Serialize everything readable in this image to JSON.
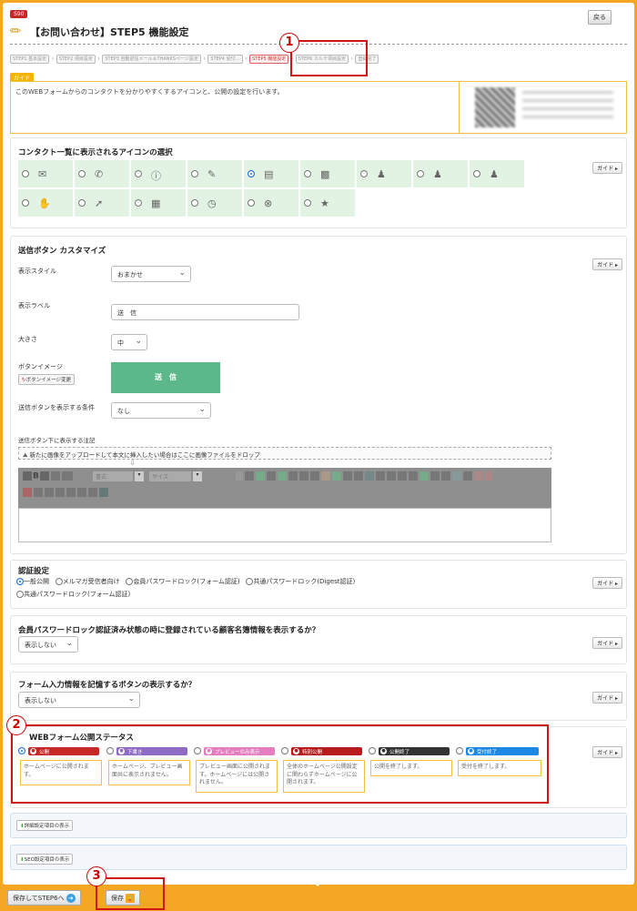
{
  "header": {
    "mark": "S90",
    "title": "【お問い合わせ】STEP5 機能設定",
    "back_label": "戻る"
  },
  "steps": [
    "STEP1 基本設定",
    "STEP2 項目設定",
    "STEP3 自動返信メール＆THANKSページ設定",
    "STEP4 受付…",
    "STEP5 機能設定",
    "STEP6 カルテ項目設定",
    "登録完了"
  ],
  "guide": {
    "badge": "ガイド",
    "text": "このWEBフォームからのコンタクトを分かりやすくするアイコンと、公開の設定を行います。"
  },
  "guide_btn": "ガイド",
  "icon_section": {
    "title": "コンタクト一覧に表示されるアイコンの選択",
    "icons": [
      "envelope-icon",
      "phone-icon",
      "exclamation-icon",
      "pencil-icon",
      "document-icon",
      "notepad-icon",
      "person-icon",
      "person-alt-icon",
      "group-icon",
      "handshake-icon",
      "arrow-icon",
      "calendar-icon",
      "clock-icon",
      "cancel-icon",
      "star-icon"
    ],
    "icon_glyphs": [
      "✉",
      "✆",
      "ⓘ",
      "✎",
      "▤",
      "▩",
      "♟",
      "♟",
      "♟",
      "✋",
      "➚",
      "▦",
      "◷",
      "⊗",
      "★"
    ],
    "selected": 4
  },
  "send_button": {
    "title": "送信ボタン カスタマイズ",
    "style_label": "表示スタイル",
    "style_value": "おまかせ",
    "display_label": "表示ラベル",
    "display_value": "送　信",
    "size_label": "大きさ",
    "size_value": "中",
    "image_label": "ボタンイメージ",
    "image_btn": "ボタンイメージ変更",
    "preview_label": "送　信",
    "condition_label": "送信ボタンを表示する条件",
    "condition_value": "なし",
    "note_label": "送信ボタン下に表示する注記",
    "dropzone": "新たに画像をアップロードして本文に挿入したい場合はここに画像ファイルをドロップ",
    "toolbar_format": "書式",
    "toolbar_size": "サイズ"
  },
  "auth": {
    "title": "認証設定",
    "options": [
      "一般公開",
      "メルマガ受信者向け",
      "会員パスワードロック(フォーム認証)",
      "共通パスワードロック(Digest認証)",
      "共通パスワードロック(フォーム認証)"
    ],
    "selected": 0
  },
  "member_info": {
    "title": "会員パスワードロック認証済み状態の時に登録されている顧客名簿情報を表示するか？",
    "value": "表示しない"
  },
  "remember": {
    "title": "フォーム入力情報を記憶するボタンの表示するか？",
    "value": "表示しない"
  },
  "publish": {
    "title": "WEBフォーム公開ステータス",
    "selected": 0,
    "options": [
      {
        "label": "公開",
        "color": "#c62828",
        "desc": "ホームページに公開されます。"
      },
      {
        "label": "下書き",
        "color": "#8e6bc4",
        "desc": "ホームページ、プレビュー画面共に表示されません。"
      },
      {
        "label": "プレビューのみ表示",
        "color": "#e57ec0",
        "desc": "プレビュー画面に公開されます。ホームページには公開されません。"
      },
      {
        "label": "特別公開",
        "color": "#b71c1c",
        "desc": "全体のホームページ公開設定に関わらずホームページに公開されます。"
      },
      {
        "label": "公開終了",
        "color": "#333333",
        "desc": "公開を終了します。"
      },
      {
        "label": "受付終了",
        "color": "#1e88e5",
        "desc": "受付を終了します。"
      }
    ]
  },
  "extra": {
    "detail": "詳細設定項目の表示",
    "seo": "SEO設定項目の表示"
  },
  "footer": {
    "save_next": "保存してSTEP6へ",
    "save": "保存"
  },
  "callouts": [
    "1",
    "2",
    "3"
  ]
}
